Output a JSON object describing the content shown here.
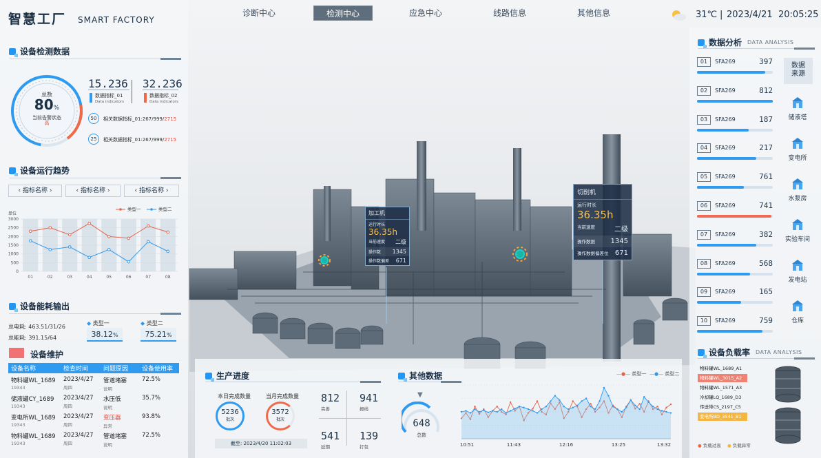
{
  "brand": {
    "title": "智慧工厂",
    "subtitle": "SMART FACTORY"
  },
  "nav": [
    "诊断中心",
    "检测中心",
    "应急中心",
    "线路信息",
    "其他信息"
  ],
  "weather": {
    "temp": "31℃",
    "date": "2023/4/21",
    "time": "20:05:25"
  },
  "detect": {
    "title": "设备检测数据",
    "ring_label": "总数",
    "ring_value": "80",
    "ring_unit": "%",
    "ring_status": "当前告警状态",
    "ring_status_value": "高",
    "m1_value": "15.236",
    "m1_label": "数据指标_01",
    "m1_sub": "Data indicators",
    "m2_value": "32.236",
    "m2_label": "数据指标_02",
    "m2_sub": "Data indicators",
    "r1_num": "50",
    "r1_text": "相关数据指标_01:267/999/",
    "r1_red": "2715",
    "r2_num": "25",
    "r2_text": "相关数据指标_01:267/999/",
    "r2_red": "2715"
  },
  "trend": {
    "title": "设备运行趋势",
    "tabs": [
      "指标名称",
      "指标名称",
      "指标名称"
    ],
    "legend1": "类型一",
    "legend2": "类型二"
  },
  "energy": {
    "title": "设备能耗输出",
    "line1": "总电耗: 463.51/31/26",
    "line2": "总能耗: 391.15/64",
    "t1_label": "类型一",
    "t1_value": "38.12",
    "t1_unit": "%",
    "t2_label": "类型二",
    "t2_value": "75.21",
    "t2_unit": "%"
  },
  "maint": {
    "title": "设备维护",
    "headers": [
      "设备名称",
      "检查时间",
      "问题原因",
      "设备使用率"
    ],
    "rows": [
      {
        "name": "物料罐WL_1689",
        "id": "19343",
        "date": "2023/4/27",
        "sub": "周四",
        "reason": "管道堵塞",
        "rsub": "说明",
        "rate": "72.5%",
        "red": false
      },
      {
        "name": "储液罐CY_1689",
        "id": "19343",
        "date": "2023/4/27",
        "sub": "周四",
        "reason": "水压低",
        "rsub": "说明",
        "rate": "35.7%",
        "red": false
      },
      {
        "name": "变电所WL_1689",
        "id": "19343",
        "date": "2023/4/27",
        "sub": "周四",
        "reason": "变压器",
        "rsub": "异常",
        "rate": "93.8%",
        "red": true
      },
      {
        "name": "物料罐WL_1689",
        "id": "19343",
        "date": "2023/4/27",
        "sub": "周四",
        "reason": "管道堵塞",
        "rsub": "说明",
        "rate": "72.5%",
        "red": false
      }
    ]
  },
  "cards": [
    {
      "title": "加工机",
      "label": "运行时长",
      "value": "36.35h",
      "level": "二级",
      "l2": "当前速度",
      "r1": "操作数",
      "v1": "1345",
      "r2": "操作数偏差",
      "v2": "671"
    },
    {
      "title": "切削机",
      "label": "运行时长",
      "value": "36.35h",
      "level": "二级",
      "l2": "当前速度",
      "r1": "操作数据",
      "v1": "1345",
      "r2": "操作数据偏差位",
      "v2": "671"
    }
  ],
  "progress": {
    "title": "生产进度",
    "day_label": "本日完成数量",
    "day_value": "5236",
    "day_unit": "批次",
    "month_label": "当月完成数量",
    "month_value": "3572",
    "month_unit": "批次",
    "update": "截至: 2023/4/20 11:02:03",
    "s1": "812",
    "s1l": "完善",
    "s2": "941",
    "s2l": "报线",
    "s3": "541",
    "s3l": "延期",
    "s4": "139",
    "s4l": "打包"
  },
  "other": {
    "title": "其他数据",
    "gauge_value": "648",
    "gauge_label": "总数",
    "legend1": "类型一",
    "legend2": "类型二"
  },
  "analysis": {
    "title": "数据分析",
    "en": "DATA ANALYSIS",
    "rows": [
      {
        "idx": "01",
        "name": "SFA269",
        "value": "397",
        "pct": 0.9,
        "red": false
      },
      {
        "idx": "02",
        "name": "SFA269",
        "value": "812",
        "pct": 1.0,
        "red": false
      },
      {
        "idx": "03",
        "name": "SFA269",
        "value": "187",
        "pct": 0.68,
        "red": false
      },
      {
        "idx": "04",
        "name": "SFA269",
        "value": "217",
        "pct": 0.78,
        "red": false
      },
      {
        "idx": "05",
        "name": "SFA269",
        "value": "761",
        "pct": 0.62,
        "red": false
      },
      {
        "idx": "06",
        "name": "SFA269",
        "value": "741",
        "pct": 0.98,
        "red": true
      },
      {
        "idx": "07",
        "name": "SFA269",
        "value": "382",
        "pct": 0.78,
        "red": false
      },
      {
        "idx": "08",
        "name": "SFA269",
        "value": "568",
        "pct": 0.7,
        "red": false
      },
      {
        "idx": "09",
        "name": "SFA269",
        "value": "165",
        "pct": 0.58,
        "red": false
      },
      {
        "idx": "10",
        "name": "SFA269",
        "value": "759",
        "pct": 0.86,
        "red": false
      }
    ]
  },
  "side": {
    "source": "数据来源",
    "items": [
      "储液塔",
      "变电所",
      "水泵房",
      "实验车间",
      "发电站",
      "仓库"
    ]
  },
  "load": {
    "title": "设备负载率",
    "en": "DATA ANALYSIS",
    "items": [
      "物料罐WL_1689_A1",
      "物料罐WL_3015_A2",
      "物料罐WL_1571_A3",
      "冷却罐LQ_1689_D3",
      "传送带CS_2197_C5",
      "变电所BD_3541_B1"
    ],
    "hl": [
      false,
      true,
      false,
      false,
      false,
      true
    ],
    "hlc": [
      "",
      "#ef8273",
      "",
      "",
      "",
      "#f5b640"
    ],
    "legend1": "负载过高",
    "legend2": "负载异常"
  },
  "chart_data": [
    {
      "type": "line",
      "title": "",
      "categories": [
        "01",
        "02",
        "03",
        "04",
        "05",
        "06",
        "07",
        "08"
      ],
      "ylabel": "单位",
      "yticks": [
        0,
        500,
        1000,
        1500,
        2000,
        2500,
        3000
      ],
      "ylim": [
        0,
        3000
      ],
      "series": [
        {
          "name": "类型一",
          "color": "#e8614a",
          "values": [
            2300,
            2500,
            2100,
            2750,
            2000,
            1900,
            2600,
            2250
          ]
        },
        {
          "name": "类型二",
          "color": "#2e9af0",
          "values": [
            1750,
            1250,
            1400,
            800,
            1250,
            550,
            1700,
            1150
          ]
        }
      ]
    },
    {
      "type": "line",
      "title": "",
      "categories": [
        "10:51",
        "11:43",
        "12:16",
        "13:25",
        "13:32"
      ],
      "ylim": [
        0,
        100
      ],
      "series": [
        {
          "name": "类型一",
          "color": "#e8614a",
          "values": [
            38,
            48,
            36,
            60,
            46,
            55,
            40,
            52,
            60,
            50,
            45,
            68,
            52,
            60,
            34,
            48,
            56,
            70,
            50,
            45,
            66,
            55,
            68,
            38,
            50,
            70,
            60,
            40,
            55,
            65,
            50,
            58,
            70,
            48,
            62,
            55,
            40,
            60,
            72,
            56,
            65,
            50,
            70,
            55,
            60,
            45,
            58,
            64
          ]
        },
        {
          "name": "类型二",
          "color": "#2e9af0",
          "values": [
            50,
            52,
            48,
            55,
            50,
            53,
            49,
            52,
            50,
            55,
            48,
            52,
            56,
            60,
            58,
            55,
            52,
            48,
            55,
            60,
            70,
            80,
            72,
            60,
            55,
            58,
            62,
            70,
            75,
            60,
            55,
            70,
            95,
            80,
            60,
            55,
            50,
            58,
            72,
            62,
            55,
            78,
            68,
            60,
            55,
            52,
            50,
            48
          ]
        }
      ]
    }
  ]
}
